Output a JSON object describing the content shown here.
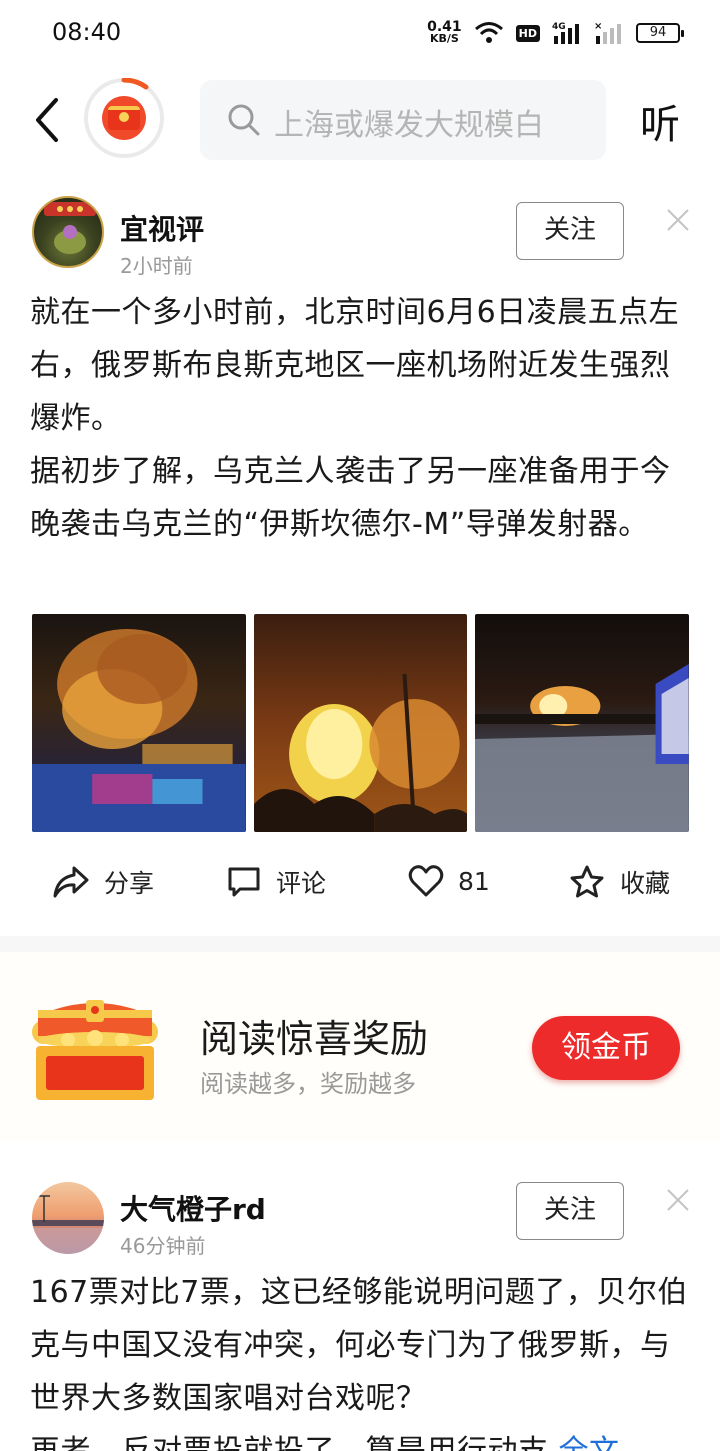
{
  "status_bar": {
    "time": "08:40",
    "net_speed_value": "0.41",
    "net_speed_unit": "KB/S",
    "hd_label": "HD",
    "signal_label": "4G",
    "battery": "94"
  },
  "top_nav": {
    "search_placeholder": "上海或爆发大规模白",
    "listen_label": "听"
  },
  "post1": {
    "author": "宜视评",
    "time": "2小时前",
    "follow_label": "关注",
    "paragraph1": "就在一个多小时前，北京时间6月6日凌晨五点左右，俄罗斯布良斯克地区一座机场附近发生强烈爆炸。",
    "paragraph2": "据初步了解，乌克兰人袭击了另一座准备用于今晚袭击乌克兰的“伊斯坎德尔-M”导弹发射器。",
    "images": [
      "explosion-photo-1",
      "explosion-photo-2",
      "explosion-photo-3"
    ],
    "actions": {
      "share": "分享",
      "comment": "评论",
      "likes": "81",
      "favorite": "收藏"
    }
  },
  "reward": {
    "title": "阅读惊喜奖励",
    "subtitle": "阅读越多，奖励越多",
    "button": "领金币"
  },
  "post2": {
    "author": "大气橙子rd",
    "time": "46分钟前",
    "follow_label": "关注",
    "paragraph1": "167票对比7票，这已经够能说明问题了，贝尔伯克与中国又没有冲突，何必专门为了俄罗斯，与世界大多数国家唱对台戏呢？",
    "paragraph2_partial": "再者，反对票投就投了，算是用行动支",
    "read_more": "全文"
  },
  "colors": {
    "accent_red": "#ee2b2b",
    "link_blue": "#1f6fd8",
    "muted_text": "#999999"
  }
}
